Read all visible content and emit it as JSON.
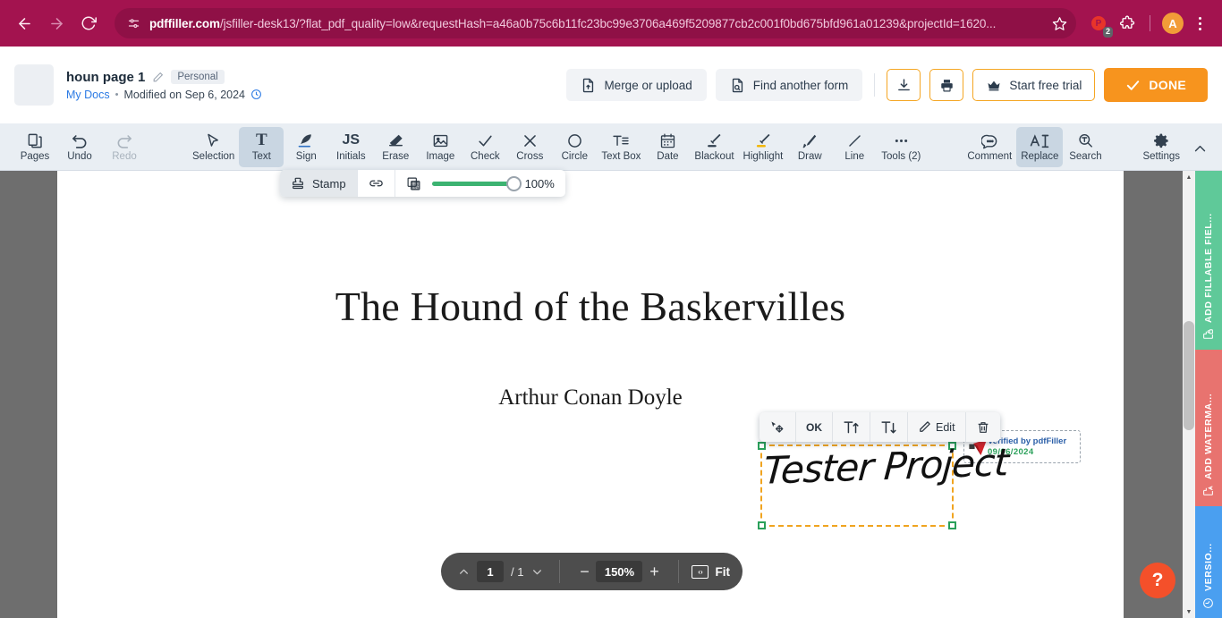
{
  "browser": {
    "back_icon": "back-arrow-icon",
    "forward_icon": "forward-arrow-icon",
    "reload_icon": "reload-icon",
    "site_info_icon": "site-settings-icon",
    "url_host": "pdffiller.com",
    "url_path": "/jsfiller-desk13/?flat_pdf_quality=low&requestHash=a46a0b75c6b11fc23bc99e3706a469f5209877cb2c001f0bd675bfd961a01239&projectId=1620...",
    "bookmark_icon": "star-icon",
    "extension_badge_count": "2",
    "extensions_icon": "puzzle-piece-icon",
    "profile_initial": "A",
    "menu_icon": "three-dot-menu-icon"
  },
  "header": {
    "doc_title": "houn page 1",
    "rename_icon": "pencil-icon",
    "tag": "Personal",
    "folder_link": "My Docs",
    "separator_dot": "•",
    "modified": "Modified on Sep 6, 2024",
    "history_icon": "clock-icon",
    "merge_label": "Merge or upload",
    "merge_icon": "file-upload-icon",
    "find_form_label": "Find another form",
    "find_form_icon": "file-search-icon",
    "download_icon": "download-icon",
    "print_icon": "printer-icon",
    "trial_label": "Start free trial",
    "trial_icon": "crown-icon",
    "done_label": "DONE",
    "done_icon": "check-icon",
    "accent_orange": "#f7941e"
  },
  "toolbar": {
    "tools": [
      {
        "label": "Pages",
        "icon": "pages-icon",
        "state": "normal"
      },
      {
        "label": "Undo",
        "icon": "undo-icon",
        "state": "normal"
      },
      {
        "label": "Redo",
        "icon": "redo-icon",
        "state": "disabled"
      },
      {
        "label": "Selection",
        "icon": "cursor-icon",
        "state": "normal"
      },
      {
        "label": "Text",
        "icon": "text-icon",
        "state": "active"
      },
      {
        "label": "Sign",
        "icon": "sign-feather-icon",
        "state": "normal"
      },
      {
        "label": "Initials",
        "icon": "initials-icon",
        "state": "normal"
      },
      {
        "label": "Erase",
        "icon": "eraser-icon",
        "state": "normal"
      },
      {
        "label": "Image",
        "icon": "image-icon",
        "state": "normal"
      },
      {
        "label": "Check",
        "icon": "check-icon",
        "state": "normal"
      },
      {
        "label": "Cross",
        "icon": "cross-icon",
        "state": "normal"
      },
      {
        "label": "Circle",
        "icon": "circle-icon",
        "state": "normal"
      },
      {
        "label": "Text Box",
        "icon": "text-box-icon",
        "state": "normal"
      },
      {
        "label": "Date",
        "icon": "calendar-icon",
        "state": "normal"
      },
      {
        "label": "Blackout",
        "icon": "blackout-marker-icon",
        "state": "normal"
      },
      {
        "label": "Highlight",
        "icon": "highlighter-icon",
        "state": "normal"
      },
      {
        "label": "Draw",
        "icon": "brush-icon",
        "state": "normal"
      },
      {
        "label": "Line",
        "icon": "line-icon",
        "state": "normal"
      },
      {
        "label": "Tools (2)",
        "icon": "ellipsis-icon",
        "state": "normal"
      },
      {
        "label": "Comment",
        "icon": "comment-icon",
        "state": "normal"
      },
      {
        "label": "Replace",
        "icon": "replace-text-icon",
        "state": "active"
      },
      {
        "label": "Search",
        "icon": "search-icon",
        "state": "normal"
      },
      {
        "label": "Settings",
        "icon": "gear-icon",
        "state": "normal"
      }
    ],
    "collapse_icon": "chevron-up-icon"
  },
  "stamp_bar": {
    "label": "Stamp",
    "stamp_icon": "stamp-icon",
    "link_icon": "link-icon",
    "opacity_icon": "opacity-checker-icon",
    "opacity_value": "100%",
    "slider_percent": 100,
    "slider_color": "#3cb371"
  },
  "document": {
    "title": "The Hound of the Baskervilles",
    "author": "Arthur Conan Doyle"
  },
  "signature": {
    "text": "Tester Project",
    "toolbar": {
      "move_icon": "move-handle-icon",
      "ok_label": "OK",
      "size_up_icon": "increase-font-icon",
      "size_down_icon": "decrease-font-icon",
      "edit_label": "Edit",
      "edit_icon": "pencil-icon",
      "delete_icon": "trash-icon"
    },
    "selection_handle_color": "#2aa05a",
    "selection_border_color": "#f0a420"
  },
  "verified_stamp": {
    "line1": "Verified by pdfFiller",
    "line2": "09/06/2024",
    "check_icon": "red-verified-check-icon"
  },
  "pager": {
    "prev_icon": "chevron-up-icon",
    "page_number": "1",
    "page_total": "/ 1",
    "next_icon": "chevron-down-icon",
    "zoom_out": "−",
    "zoom_value": "150%",
    "zoom_in": "+",
    "fit_label": "Fit",
    "fit_icon": "fit-width-icon"
  },
  "side_tabs": [
    {
      "label": "ADD FILLABLE FIEL...",
      "icon": "add-fillable-field-icon",
      "color": "#5fc999"
    },
    {
      "label": "ADD WATERMA...",
      "icon": "add-watermark-icon",
      "color": "#e8736f"
    },
    {
      "label": "VERSIO...",
      "icon": "version-history-icon",
      "color": "#4a9ff0"
    }
  ],
  "help": {
    "label": "?",
    "color": "#f4502a"
  }
}
